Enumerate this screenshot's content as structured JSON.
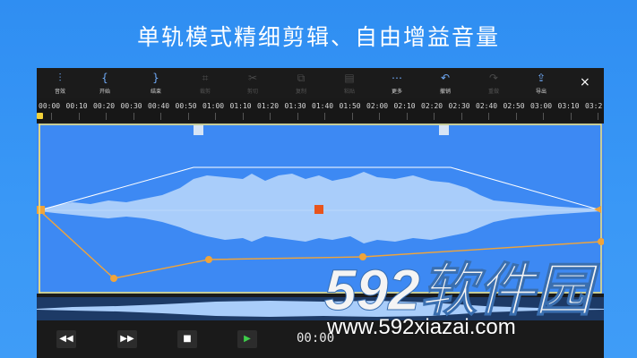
{
  "headline": "单轨模式精细剪辑、自由增益音量",
  "toolbar": {
    "tools": [
      {
        "label": "音效",
        "icon": "equalizer-icon",
        "enabled": true
      },
      {
        "label": "开始",
        "icon": "set-start-icon",
        "enabled": true
      },
      {
        "label": "结束",
        "icon": "set-end-icon",
        "enabled": true
      },
      {
        "label": "裁剪",
        "icon": "crop-icon",
        "enabled": false
      },
      {
        "label": "剪切",
        "icon": "scissors-icon",
        "enabled": false
      },
      {
        "label": "复制",
        "icon": "copy-icon",
        "enabled": false
      },
      {
        "label": "粘贴",
        "icon": "paste-icon",
        "enabled": false
      },
      {
        "label": "更多",
        "icon": "more-icon",
        "enabled": true
      },
      {
        "label": "撤销",
        "icon": "undo-icon",
        "enabled": true
      },
      {
        "label": "重做",
        "icon": "redo-icon",
        "enabled": false
      },
      {
        "label": "导出",
        "icon": "export-icon",
        "enabled": true
      }
    ],
    "close": "×"
  },
  "timeline": {
    "ticks": [
      "00:00",
      "00:10",
      "00:20",
      "00:30",
      "00:40",
      "00:50",
      "01:00",
      "01:10",
      "01:20",
      "01:30",
      "01:40",
      "01:50",
      "02:00",
      "02:10",
      "02:20",
      "02:30",
      "02:40",
      "02:50",
      "03:00",
      "03:10",
      "03:2"
    ]
  },
  "transport": {
    "rewind": "◀◀",
    "forward": "▶▶",
    "stop": "■",
    "play": "▶",
    "time": "00:00"
  },
  "watermark": {
    "logo_text": "592软件园",
    "url": "www.592xiazai.com"
  },
  "colors": {
    "background": "#2f8ef2",
    "wave_area": "#3d89f3",
    "waveform": "#a9cdfa",
    "accent_orange": "#f0a43a",
    "play_green": "#3ecf4a",
    "marker_red": "#e8541c"
  }
}
